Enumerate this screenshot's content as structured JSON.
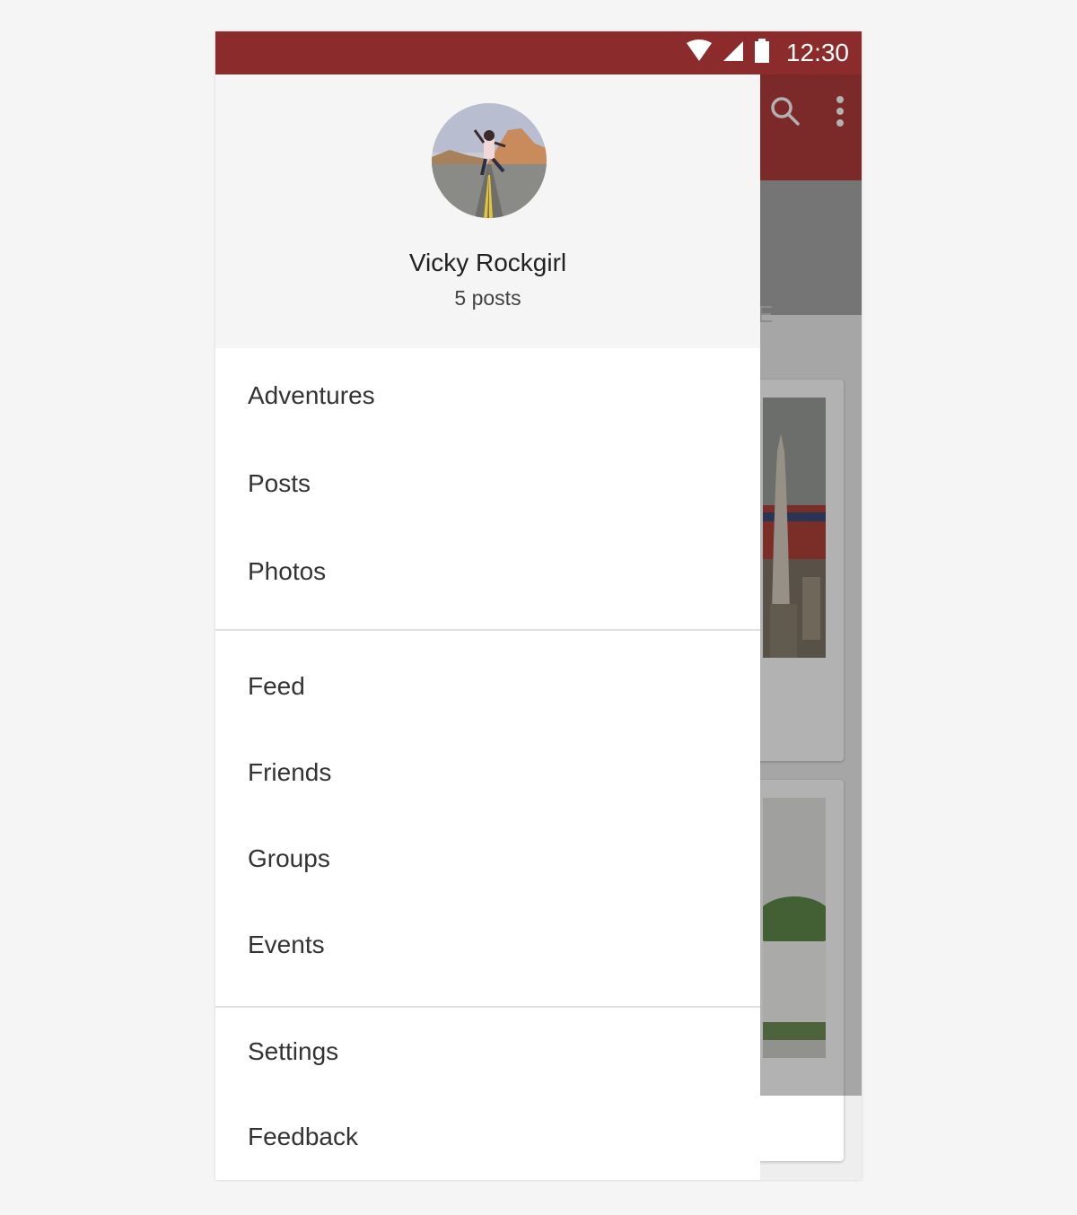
{
  "status_bar": {
    "time": "12:30",
    "wifi_icon": "wifi-icon",
    "signal_icon": "signal-icon",
    "battery_icon": "battery-icon",
    "color": "#8c2b2b"
  },
  "app_bar": {
    "color": "#b13b3b",
    "search_icon": "search-icon",
    "overflow_icon": "more-vert-icon",
    "tab_fragment": "E"
  },
  "drawer": {
    "profile": {
      "name": "Vicky Rockgirl",
      "posts": "5 posts",
      "avatar": "profile-photo"
    },
    "primary_items": [
      {
        "label": "Adventures"
      },
      {
        "label": "Posts"
      },
      {
        "label": "Photos"
      }
    ],
    "secondary_items": [
      {
        "label": "Feed"
      },
      {
        "label": "Friends"
      },
      {
        "label": "Groups"
      },
      {
        "label": "Events"
      }
    ],
    "footer_items": [
      {
        "label": "Settings"
      },
      {
        "label": "Feedback"
      }
    ]
  }
}
